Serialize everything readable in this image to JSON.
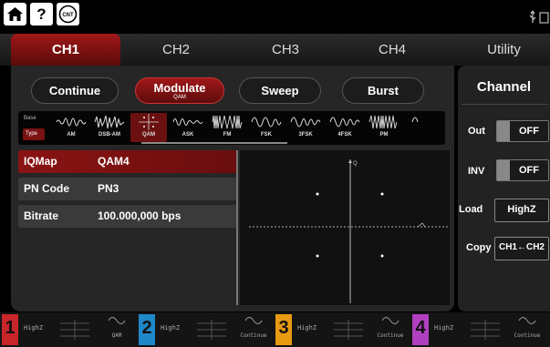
{
  "topbar": {
    "home_icon": "home-icon",
    "help_label": "?",
    "help_icon": "help-icon",
    "cnt_label": "CNT",
    "cnt_icon": "counter-icon",
    "usb_icon": "usb-icon"
  },
  "tabs": [
    {
      "label": "CH1",
      "active": true
    },
    {
      "label": "CH2"
    },
    {
      "label": "CH3"
    },
    {
      "label": "CH4"
    },
    {
      "label": "Utility"
    }
  ],
  "modes": {
    "continue": "Continue",
    "modulate": "Modulate",
    "modulate_sub": "QAM",
    "sweep": "Sweep",
    "burst": "Burst"
  },
  "wavebar": {
    "base": "Base",
    "type": "Type",
    "items": [
      "AM",
      "DSB-AM",
      "QAM",
      "ASK",
      "FM",
      "FSK",
      "3FSK",
      "4FSK",
      "PM"
    ],
    "selected": "QAM"
  },
  "params": [
    {
      "key": "IQMap",
      "value": "QAM4"
    },
    {
      "key": "PN Code",
      "value": "PN3"
    },
    {
      "key": "Bitrate",
      "value": "100.000,000 bps"
    }
  ],
  "plot": {
    "axis_label": "Q"
  },
  "side": {
    "title": "Channel",
    "out_label": "Out",
    "out_value": "OFF",
    "inv_label": "INV",
    "inv_value": "OFF",
    "load_label": "Load",
    "load_value": "HighZ",
    "copy_label": "Copy",
    "copy_value": "CH1←CH2"
  },
  "bottom": {
    "channels": [
      {
        "num": "1",
        "load": "HighZ",
        "mode": "QAM",
        "color": "#c8252a"
      },
      {
        "num": "2",
        "load": "HighZ",
        "mode": "Continue",
        "color": "#1e88c8"
      },
      {
        "num": "3",
        "load": "HighZ",
        "mode": "Continue",
        "color": "#e89a12"
      },
      {
        "num": "4",
        "load": "HighZ",
        "mode": "Continue",
        "color": "#b040c0"
      }
    ]
  },
  "colors": {
    "accent": "#a01818",
    "panel": "#262626"
  }
}
